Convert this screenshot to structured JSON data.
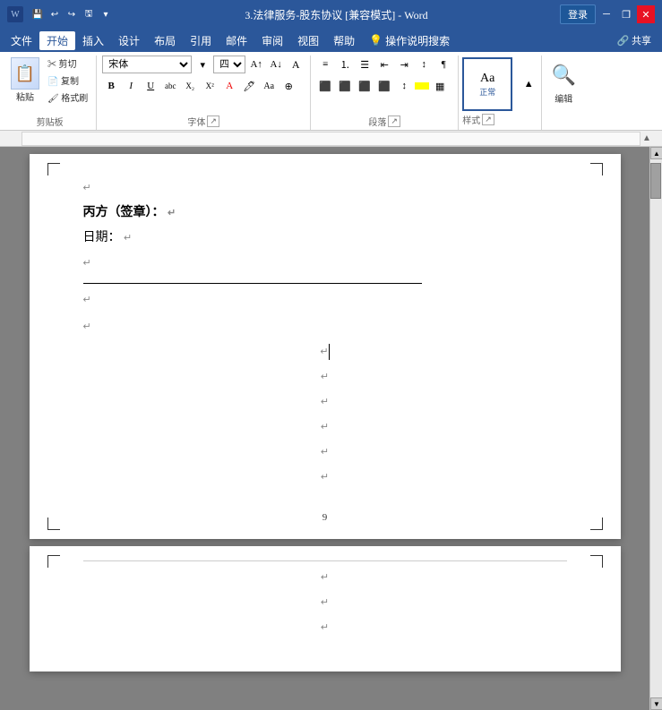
{
  "titlebar": {
    "title": "3.法律服务-股东协议 [兼容模式] - Word",
    "login_label": "登录",
    "app_name": "Word"
  },
  "menubar": {
    "items": [
      "文件",
      "开始",
      "插入",
      "设计",
      "布局",
      "引用",
      "邮件",
      "审阅",
      "视图",
      "帮助",
      "操作说明搜索"
    ],
    "active": "开始"
  },
  "ribbon": {
    "groups": [
      {
        "name": "剪贴板",
        "buttons": [
          "粘贴",
          "剪切",
          "复制",
          "格式刷"
        ]
      },
      {
        "name": "字体",
        "font_name": "宋体",
        "font_size": "四号",
        "bold": "B",
        "italic": "I",
        "underline": "U",
        "strikethrough": "abc",
        "subscript": "X₂",
        "superscript": "X²"
      },
      {
        "name": "段落"
      },
      {
        "name": "样式",
        "style_label": "样式"
      },
      {
        "name": "编辑",
        "label": "编辑"
      }
    ]
  },
  "document": {
    "page1": {
      "lines": [
        {
          "text": "丙方（签章）：",
          "type": "normal",
          "bold": true
        },
        {
          "text": "日期：",
          "type": "normal"
        },
        {
          "text": "",
          "type": "empty"
        },
        {
          "text": "signature_line",
          "type": "signature"
        },
        {
          "text": "",
          "type": "empty"
        },
        {
          "text": "",
          "type": "empty"
        },
        {
          "text": "",
          "type": "cursor"
        },
        {
          "text": "",
          "type": "empty"
        },
        {
          "text": "",
          "type": "empty"
        },
        {
          "text": "",
          "type": "empty"
        },
        {
          "text": "",
          "type": "empty"
        },
        {
          "text": "",
          "type": "empty"
        }
      ],
      "page_number": "9"
    },
    "page2": {
      "lines": [
        {
          "text": "",
          "type": "empty"
        },
        {
          "text": "",
          "type": "empty"
        },
        {
          "text": "",
          "type": "empty"
        }
      ]
    }
  }
}
